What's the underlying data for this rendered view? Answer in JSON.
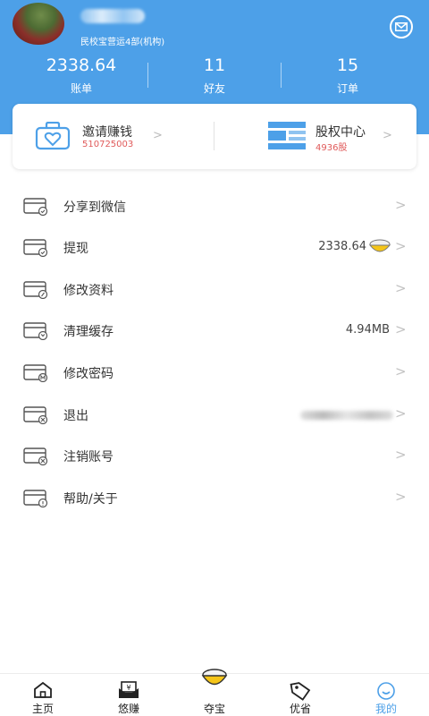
{
  "header": {
    "org_name": "民校宝营运4部(机构)",
    "stats": [
      {
        "value": "2338.64",
        "label": "账单"
      },
      {
        "value": "11",
        "label": "好友"
      },
      {
        "value": "15",
        "label": "订单"
      }
    ],
    "icons": {
      "mail": "mail-icon",
      "avatar": "avatar"
    }
  },
  "cards": {
    "invite": {
      "title": "邀请赚钱",
      "sub": "510725003",
      "chevron": ">"
    },
    "equity": {
      "title": "股权中心",
      "sub": "4936股",
      "chevron": ">"
    }
  },
  "menu": [
    {
      "label": "分享到微信",
      "value": "",
      "chevron": ">"
    },
    {
      "label": "提现",
      "value": "2338.64",
      "chevron": ">"
    },
    {
      "label": "修改资料",
      "value": "",
      "chevron": ">"
    },
    {
      "label": "清理缓存",
      "value": "4.94MB",
      "chevron": ">"
    },
    {
      "label": "修改密码",
      "value": "",
      "chevron": ">"
    },
    {
      "label": "退出",
      "value": "",
      "chevron": ">"
    },
    {
      "label": "注销账号",
      "value": "",
      "chevron": ">"
    },
    {
      "label": "帮助/关于",
      "value": "",
      "chevron": ">"
    }
  ],
  "tabs": [
    {
      "label": "主页",
      "icon": "home-icon"
    },
    {
      "label": "悠赚",
      "icon": "wallet-icon"
    },
    {
      "label": "夺宝",
      "icon": "treasure-bowl-icon"
    },
    {
      "label": "优省",
      "icon": "tag-icon"
    },
    {
      "label": "我的",
      "icon": "smile-icon",
      "active": true
    }
  ],
  "colors": {
    "brand_blue": "#4da0e8",
    "card_sub_red": "#e05a5a",
    "coin_yellow": "#f5c518"
  }
}
